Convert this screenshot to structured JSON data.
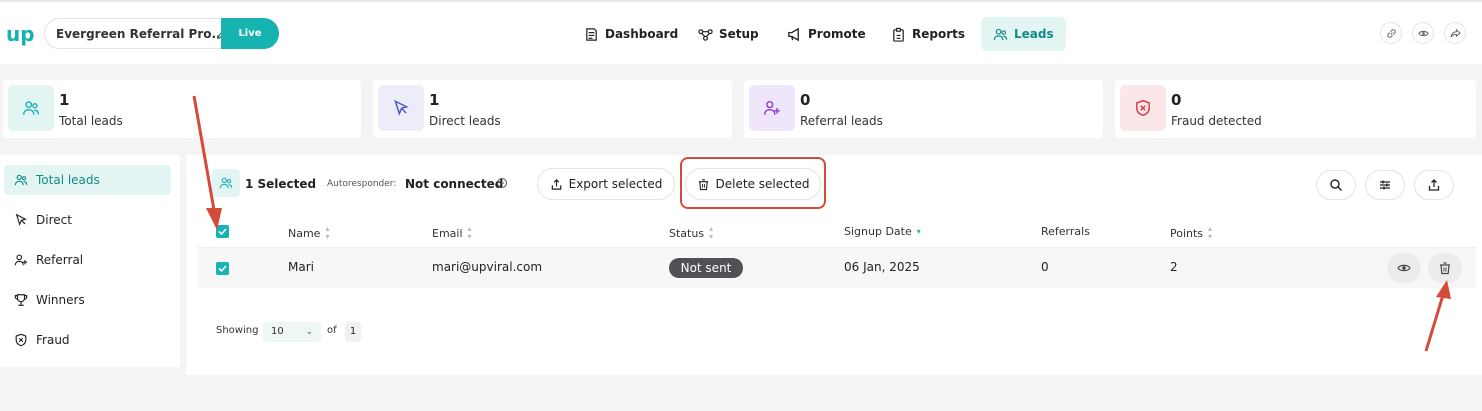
{
  "header": {
    "logo_text": "up",
    "campaign_name": "Evergreen Referral Pro...",
    "campaign_status": "Live",
    "nav": [
      {
        "label": "Dashboard",
        "icon": "dashboard-icon"
      },
      {
        "label": "Setup",
        "icon": "setup-icon"
      },
      {
        "label": "Promote",
        "icon": "megaphone-icon"
      },
      {
        "label": "Reports",
        "icon": "clipboard-icon"
      },
      {
        "label": "Leads",
        "icon": "users-icon",
        "active": true
      }
    ],
    "right_icons": [
      "link-icon",
      "eye-icon",
      "share-icon"
    ]
  },
  "stats": [
    {
      "value": "1",
      "label": "Total leads",
      "icon": "users-icon",
      "bg": "#e3f5f3",
      "color": "#17b3b0"
    },
    {
      "value": "1",
      "label": "Direct leads",
      "icon": "cursor-icon",
      "bg": "#ecedf9",
      "color": "#4b57c8"
    },
    {
      "value": "0",
      "label": "Referral leads",
      "icon": "user-plus-icon",
      "bg": "#f0e6fb",
      "color": "#8b3fd6"
    },
    {
      "value": "0",
      "label": "Fraud detected",
      "icon": "shield-x-icon",
      "bg": "#fbe6e8",
      "color": "#d23b4a"
    }
  ],
  "sidebar": {
    "items": [
      {
        "label": "Total leads",
        "icon": "users-icon",
        "active": true
      },
      {
        "label": "Direct",
        "icon": "cursor-icon"
      },
      {
        "label": "Referral",
        "icon": "user-plus-icon"
      },
      {
        "label": "Winners",
        "icon": "trophy-icon"
      },
      {
        "label": "Fraud",
        "icon": "shield-x-icon"
      }
    ]
  },
  "toolbar": {
    "selected_text": "1 Selected",
    "autoresponder_label": "Autoresponder:",
    "autoresponder_value": "Not connected",
    "export_label": "Export selected",
    "delete_label": "Delete selected"
  },
  "table": {
    "columns": [
      "Name",
      "Email",
      "Status",
      "Signup Date",
      "Referrals",
      "Points"
    ],
    "rows": [
      {
        "name": "Mari",
        "email": "mari@upviral.com",
        "status": "Not sent",
        "signup_date": "06 Jan, 2025",
        "referrals": "0",
        "points": "2"
      }
    ]
  },
  "pagination": {
    "showing_label": "Showing",
    "per_page": "10",
    "of_label": "of",
    "total_pages": "1"
  },
  "colors": {
    "accent": "#17b3b0",
    "annotation": "#d64a3a"
  }
}
